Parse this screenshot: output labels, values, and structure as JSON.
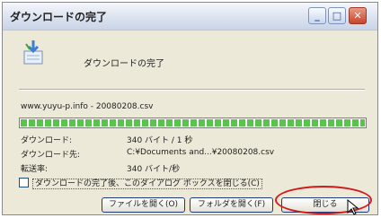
{
  "window": {
    "title": "ダウンロードの完了",
    "controls": {
      "minimize": "_",
      "maximize": "□",
      "close": "✕"
    }
  },
  "status_text": "ダウンロードの完了",
  "icons": {
    "download": "download-icon",
    "cursor": "cursor-icon"
  },
  "file": {
    "name": "www.yuyu-p.info - 20080208.csv"
  },
  "progress": {
    "percent": 100,
    "color": "#59c34b"
  },
  "details": [
    {
      "label": "ダウンロード:",
      "value": "340 バイト / 1 秒"
    },
    {
      "label": "ダウンロード先:",
      "value": "C:¥Documents and...¥20080208.csv"
    },
    {
      "label": "転送率:",
      "value": "340 バイト/秒"
    }
  ],
  "checkbox": {
    "label": "ダウンロードの完了後、このダイアログ ボックスを閉じる(C)",
    "checked": false
  },
  "buttons": {
    "open_file": "ファイルを開く(O)",
    "open_folder": "フォルダを開く(F)",
    "close": "閉じる"
  },
  "highlight_color": "#d11a1a"
}
